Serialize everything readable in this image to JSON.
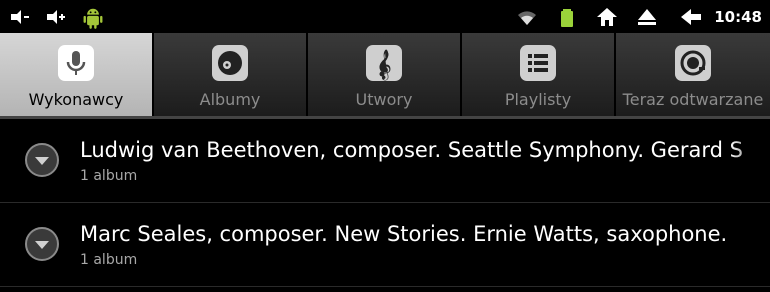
{
  "status_bar": {
    "left_icons": [
      "usb-debug-icon",
      "usb-icon",
      "android-icon"
    ],
    "right_icons": [
      "wifi-icon",
      "battery-icon",
      "home-icon",
      "eject-icon",
      "back-icon"
    ],
    "time": "10:48"
  },
  "tabs": [
    {
      "label": "Wykonawcy",
      "icon": "microphone-icon",
      "active": true
    },
    {
      "label": "Albumy",
      "icon": "disc-icon",
      "active": false
    },
    {
      "label": "Utwory",
      "icon": "music-note-icon",
      "active": false
    },
    {
      "label": "Playlisty",
      "icon": "playlist-icon",
      "active": false
    },
    {
      "label": "Teraz odtwarzane",
      "icon": "now-playing-icon",
      "active": false
    }
  ],
  "artists": [
    {
      "name": "Ludwig van Beethoven, composer. Seattle Symphony. Gerard S",
      "count": "1 album"
    },
    {
      "name": "Marc Seales, composer. New Stories. Ernie Watts, saxophone.",
      "count": "1 album"
    }
  ],
  "colors": {
    "active_tab": "#d6d6d6",
    "background": "#000000",
    "android_green": "#a4c639"
  }
}
